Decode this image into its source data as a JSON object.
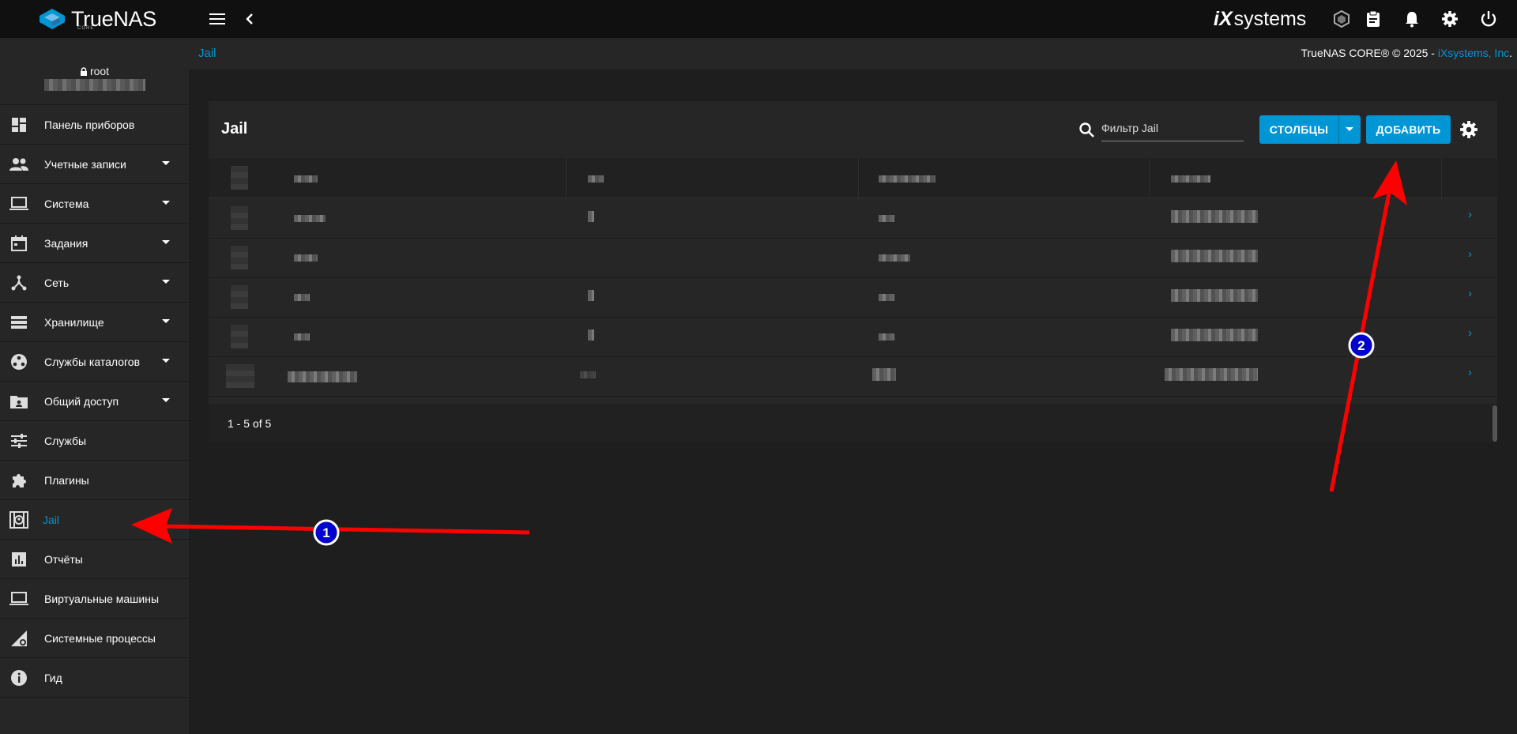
{
  "topbar": {
    "brand": "TrueNAS",
    "brand_sub": "CORE",
    "vendor_prefix": "iX",
    "vendor_suffix": "systems",
    "icons": [
      "menu-icon",
      "back-icon",
      "truecommand-icon",
      "clipboard-icon",
      "bell-icon",
      "settings-icon",
      "power-icon"
    ]
  },
  "sidebar": {
    "user": "root",
    "items": [
      {
        "label": "Панель приборов",
        "icon": "dashboard-icon",
        "caret": false
      },
      {
        "label": "Учетные записи",
        "icon": "accounts-icon",
        "caret": true
      },
      {
        "label": "Система",
        "icon": "system-icon",
        "caret": true
      },
      {
        "label": "Задания",
        "icon": "calendar-icon",
        "caret": true
      },
      {
        "label": "Сеть",
        "icon": "network-icon",
        "caret": true
      },
      {
        "label": "Хранилище",
        "icon": "storage-icon",
        "caret": true
      },
      {
        "label": "Службы каталогов",
        "icon": "directory-icon",
        "caret": true
      },
      {
        "label": "Общий доступ",
        "icon": "sharing-icon",
        "caret": true
      },
      {
        "label": "Службы",
        "icon": "services-icon",
        "caret": false
      },
      {
        "label": "Плагины",
        "icon": "plugins-icon",
        "caret": false
      },
      {
        "label": "Jail",
        "icon": "jail-icon",
        "caret": false,
        "active": true
      },
      {
        "label": "Отчёты",
        "icon": "reports-icon",
        "caret": false
      },
      {
        "label": "Виртуальные машины",
        "icon": "vm-icon",
        "caret": false
      },
      {
        "label": "Системные процессы",
        "icon": "processes-icon",
        "caret": false
      },
      {
        "label": "Гид",
        "icon": "info-icon",
        "caret": false
      }
    ]
  },
  "breadcrumb": "Jail",
  "copyright": {
    "text": "TrueNAS CORE® © 2025 - ",
    "link": "iXsystems, Inc",
    "end": "."
  },
  "card": {
    "title": "Jail",
    "filter_placeholder": "Фильтр Jail",
    "columns_button": "СТОЛБЦЫ",
    "add_button": "ДОБАВИТЬ",
    "row_count": 5,
    "pager": "1 - 5 of 5"
  },
  "annotations": [
    {
      "number": "1",
      "color": "#ff0000",
      "badge": "#0000cc"
    },
    {
      "number": "2",
      "color": "#ff0000",
      "badge": "#0000cc"
    }
  ],
  "colors": {
    "accent": "#0095d5",
    "bg": "#1e1e1e",
    "panel": "#262626",
    "topbar": "#101010"
  }
}
